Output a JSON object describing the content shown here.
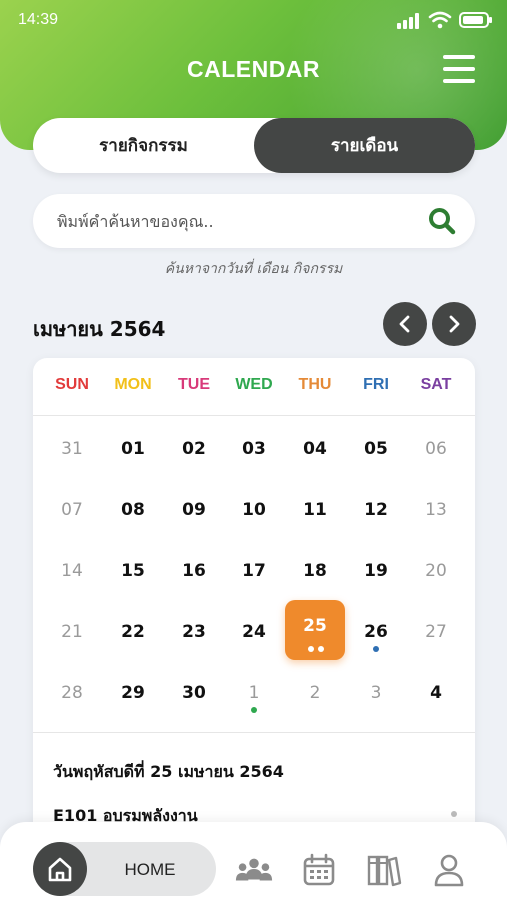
{
  "status_bar": {
    "time": "14:39"
  },
  "header": {
    "title": "CALENDAR",
    "menu_icon": "hamburger-menu-icon"
  },
  "tabs": {
    "activity": "รายกิจกรรม",
    "month": "รายเดือน",
    "active": "month"
  },
  "search": {
    "placeholder": "พิมพ์คำค้นหาของคุณ..",
    "value": "",
    "hint": "ค้นหาจากวันที่  เดือน กิจกรรม"
  },
  "calendar": {
    "month_title": "เมษายน 2564",
    "weekdays": [
      {
        "label": "SUN",
        "color": "#e23b3b"
      },
      {
        "label": "MON",
        "color": "#f2c01a"
      },
      {
        "label": "TUE",
        "color": "#d83a7a"
      },
      {
        "label": "WED",
        "color": "#2fa84f"
      },
      {
        "label": "THU",
        "color": "#e58a37"
      },
      {
        "label": "FRI",
        "color": "#2f6fb3"
      },
      {
        "label": "SAT",
        "color": "#7a3fa0"
      }
    ],
    "weeks": [
      [
        "31",
        "01",
        "02",
        "03",
        "04",
        "05",
        "06"
      ],
      [
        "07",
        "08",
        "09",
        "10",
        "11",
        "12",
        "13"
      ],
      [
        "14",
        "15",
        "16",
        "17",
        "18",
        "19",
        "20"
      ],
      [
        "21",
        "22",
        "23",
        "24",
        "25",
        "26",
        "27"
      ],
      [
        "28",
        "29",
        "30",
        "1",
        "2",
        "3",
        "4"
      ]
    ],
    "selected_day": "25"
  },
  "event_detail": {
    "date_text": "วันพฤหัสบดีที่ 25 เมษายน 2564",
    "event_text": "E101 อบรมพลังงาน"
  },
  "bottom_nav": {
    "home_label": "HOME"
  },
  "colors": {
    "accent_green": "#6cbf3c",
    "dark": "#444645",
    "today_orange": "#ef8a2c",
    "dot_blue": "#2f6fb3",
    "dot_green": "#2fa84f"
  }
}
